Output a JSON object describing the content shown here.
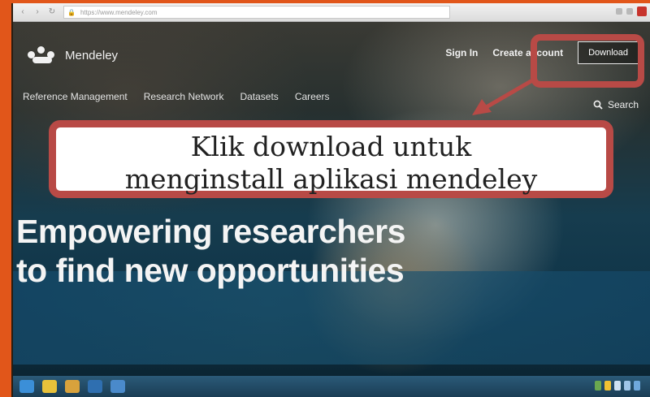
{
  "browser": {
    "address": "https://www.mendeley.com"
  },
  "site": {
    "brand": "Mendeley",
    "header_links": {
      "sign_in": "Sign In",
      "create_account": "Create account",
      "download": "Download"
    },
    "nav": [
      "Reference Management",
      "Research Network",
      "Datasets",
      "Careers"
    ],
    "search_label": "Search",
    "hero_line1": "Empowering researchers",
    "hero_line2": "to find new opportunities"
  },
  "annotation": {
    "line1": "Klik download untuk",
    "line2": "menginstall aplikasi mendeley",
    "color": "#b84a46"
  },
  "icons": [
    "back-icon",
    "forward-icon",
    "reload-icon",
    "lock-icon",
    "search-icon",
    "mendeley-logo-icon",
    "arrow-icon"
  ],
  "colors": {
    "frame": "#e1561a",
    "highlight": "#b84a46"
  }
}
